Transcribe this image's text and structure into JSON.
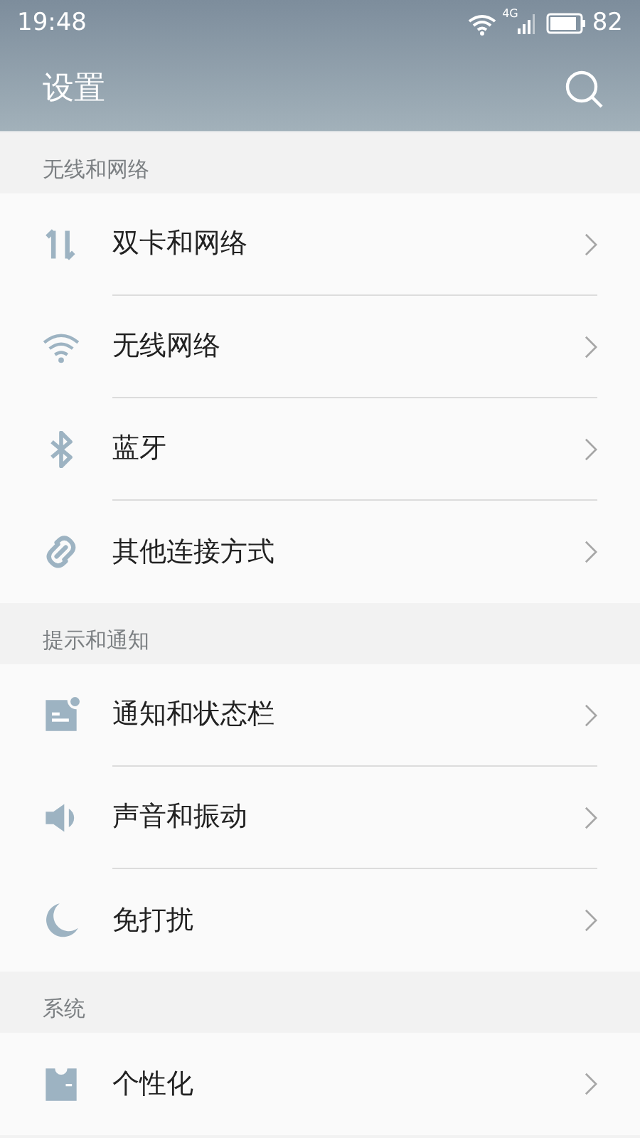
{
  "status_bar": {
    "time": "19:48",
    "network": "4G",
    "battery": "82"
  },
  "header": {
    "title": "设置"
  },
  "sections": [
    {
      "title": "无线和网络",
      "items": [
        {
          "label": "双卡和网络"
        },
        {
          "label": "无线网络"
        },
        {
          "label": "蓝牙"
        },
        {
          "label": "其他连接方式"
        }
      ]
    },
    {
      "title": "提示和通知",
      "items": [
        {
          "label": "通知和状态栏"
        },
        {
          "label": "声音和振动"
        },
        {
          "label": "免打扰"
        }
      ]
    },
    {
      "title": "系统",
      "items": [
        {
          "label": "个性化"
        }
      ]
    }
  ]
}
